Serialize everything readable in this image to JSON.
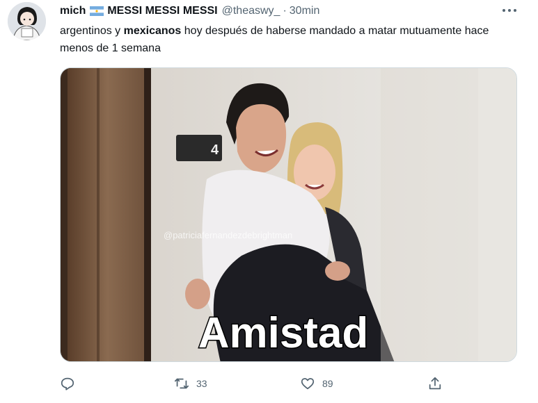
{
  "tweet": {
    "author_name": "mich",
    "display_name": "MESSI MESSI MESSI",
    "handle": "@theaswy_",
    "separator": "·",
    "time": "30min",
    "text_part1": "argentinos y ",
    "text_bold": "mexicanos",
    "text_part2": " hoy después de haberse mandado a matar mutuamente hace menos de 1 semana",
    "icons": [
      "argentina-flag-icon",
      "more-icon",
      "reply-icon",
      "retweet-icon",
      "like-icon",
      "share-icon"
    ]
  },
  "media": {
    "caption": "Amistad",
    "watermark": "@patriciafernandezdebrightman",
    "door_number": "4"
  },
  "actions": {
    "reply_count": "",
    "retweet_count": "33",
    "like_count": "89"
  },
  "colors": {
    "muted": "#536471",
    "text": "#0f1419",
    "flag_blue": "#74acdf"
  }
}
